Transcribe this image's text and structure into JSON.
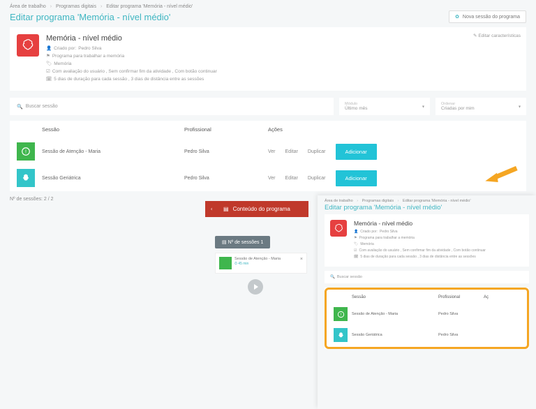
{
  "breadcrumb": {
    "a": "Área de trabalho",
    "b": "Programas digitais",
    "c": "Editar programa 'Memória - nível médio'"
  },
  "page_title": "Editar programa 'Memória - nível médio'",
  "new_session_btn": "Nova sessão do programa",
  "program": {
    "name": "Memória - nível médio",
    "created_by_label": "Criado por:",
    "created_by": "Pedro Silva",
    "desc": "Programa para trabalhar a memória",
    "tag": "Memória",
    "eval": "Com avaliação do usuário , Sem confirmar fim da atividade , Com botão continuar",
    "duration": "5 dias de duração para cada sessão , 3 dias de distância entre as sessões",
    "edit_chars": "Editar características"
  },
  "filters": {
    "search_placeholder": "Buscar sessão",
    "select1_label": "Módulo",
    "select1_value": "Último mês",
    "select2_label": "Ordenar",
    "select2_value": "Criadas por mim"
  },
  "table": {
    "col_session": "Sessão",
    "col_prof": "Profissional",
    "col_actions": "Ações",
    "action_view": "Ver",
    "action_edit": "Editar",
    "action_dup": "Duplicar",
    "action_add": "Adicionar",
    "rows": [
      {
        "name": "Sessão de Atenção - Maria",
        "prof": "Pedro Silva",
        "icon": "green"
      },
      {
        "name": "Sessão Geriátrica",
        "prof": "Pedro Silva",
        "icon": "teal"
      }
    ]
  },
  "summary": "Nº de sessões: 2 / 2",
  "content_header": "Conteúdo do programa",
  "sessions_badge": "Nº de sessões 1",
  "mini": {
    "name": "Sessão de Atenção - Maria",
    "dur": "45 min"
  },
  "sub": {
    "breadcrumb": {
      "a": "Área de trabalho",
      "b": "Programas digitais",
      "c": "Editar programa 'Memória - nível médio'"
    },
    "title": "Editar programa 'Memória - nível médio'",
    "program": {
      "name": "Memória - nível médio",
      "created_by_label": "Criado por:",
      "created_by": "Pedro Silva",
      "desc": "Programa para trabalhar a memória",
      "tag": "Memória",
      "eval": "Com avaliação do usuário , Sem confirmar fim da atividade , Com botão continuar",
      "duration": "5 dias de duração para cada sessão , 3 dias de distância entre as sessões"
    },
    "search_placeholder": "Buscar sessão",
    "table": {
      "col_session": "Sessão",
      "col_prof": "Profissional",
      "col_actions": "Aç",
      "rows": [
        {
          "name": "Sessão de Atenção - Maria",
          "prof": "Pedro Silva",
          "icon": "green"
        },
        {
          "name": "Sessão Geriátrica",
          "prof": "Pedro Silva",
          "icon": "teal"
        }
      ]
    }
  }
}
